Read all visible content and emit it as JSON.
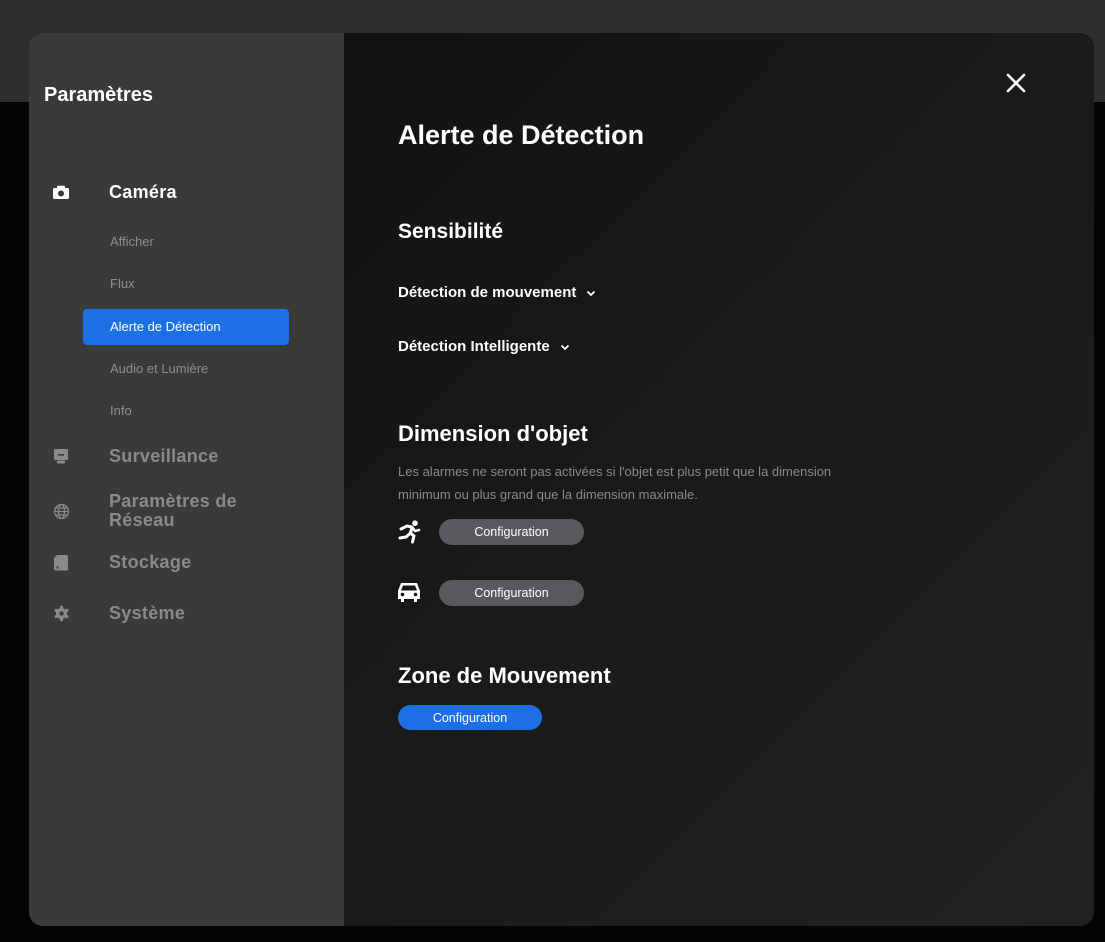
{
  "sidebar": {
    "title": "Paramètres",
    "camera": {
      "label": "Caméra",
      "icon": "camera-icon"
    },
    "camera_items": [
      {
        "label": "Afficher"
      },
      {
        "label": "Flux"
      },
      {
        "label": "Alerte de Détection",
        "selected": true
      },
      {
        "label": "Audio et Lumière"
      },
      {
        "label": "Info"
      }
    ],
    "surveillance": {
      "label": "Surveillance",
      "icon": "monitor-icon"
    },
    "network": {
      "label_line1": "Paramètres de",
      "label_line2": "Réseau",
      "icon": "globe-icon"
    },
    "storage": {
      "label": "Stockage",
      "icon": "storage-icon"
    },
    "system": {
      "label": "Système",
      "icon": "gear-icon"
    }
  },
  "main": {
    "title": "Alerte de Détection",
    "sensitivity": {
      "heading": "Sensibilité",
      "motion_detection": "Détection de mouvement",
      "smart_detection": "Détection Intelligente"
    },
    "object_size": {
      "heading": "Dimension d'objet",
      "description": "Les alarmes ne seront pas activées si l'objet est plus petit que la dimension minimum ou plus grand que la dimension maximale.",
      "person_button": "Configuration",
      "vehicle_button": "Configuration"
    },
    "motion_zone": {
      "heading": "Zone de Mouvement",
      "button": "Configuration"
    }
  },
  "colors": {
    "accent": "#1d6fe4",
    "sidebar_bg": "#3a3a3a",
    "content_bg": "#181818",
    "gray_button": "#57595d",
    "muted_text": "#8a8a8a"
  }
}
